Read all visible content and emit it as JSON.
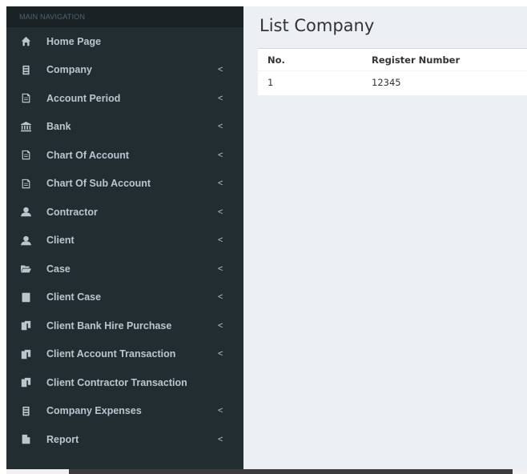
{
  "sidebar": {
    "header": "MAIN NAVIGATION",
    "items": [
      {
        "label": "Home Page",
        "icon": "home-icon",
        "arrow": ""
      },
      {
        "label": "Company",
        "icon": "building-icon",
        "arrow": "<"
      },
      {
        "label": "Account Period",
        "icon": "file-text-icon",
        "arrow": "<"
      },
      {
        "label": "Bank",
        "icon": "bank-icon",
        "arrow": "<"
      },
      {
        "label": "Chart Of Account",
        "icon": "file-text-icon",
        "arrow": "<"
      },
      {
        "label": "Chart Of Sub Account",
        "icon": "file-text-icon",
        "arrow": "<"
      },
      {
        "label": "Contractor",
        "icon": "user-icon",
        "arrow": "<"
      },
      {
        "label": "Client",
        "icon": "user-icon",
        "arrow": "<"
      },
      {
        "label": "Case",
        "icon": "folder-open-icon",
        "arrow": "<"
      },
      {
        "label": "Client Case",
        "icon": "book-icon",
        "arrow": "<"
      },
      {
        "label": "Client Bank Hire Purchase",
        "icon": "copy-icon",
        "arrow": "<"
      },
      {
        "label": "Client Account Transaction",
        "icon": "copy-icon",
        "arrow": "<"
      },
      {
        "label": "Client Contractor Transaction",
        "icon": "copy-icon",
        "arrow": ""
      },
      {
        "label": "Company Expenses",
        "icon": "building-icon",
        "arrow": "<"
      },
      {
        "label": "Report",
        "icon": "file-icon",
        "arrow": "<"
      }
    ]
  },
  "main": {
    "title": "List Company",
    "table": {
      "headers": [
        "No.",
        "Register Number"
      ],
      "rows": [
        [
          "1",
          "12345"
        ]
      ]
    }
  }
}
